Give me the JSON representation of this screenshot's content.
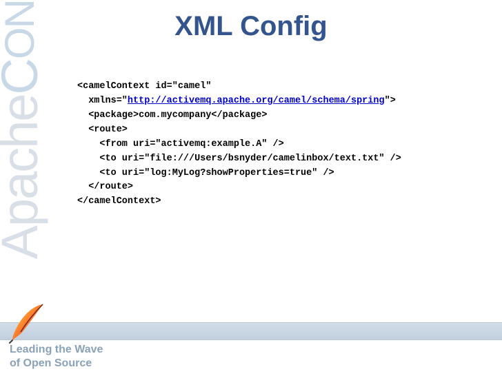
{
  "brand": {
    "part1": "Apache",
    "part2_c": "C",
    "part2_on": "ON"
  },
  "title": "XML Config",
  "code": {
    "line1": "<camelContext id=\"camel\"",
    "line2a": "  xmlns=\"",
    "line2_url": "http://activemq.apache.org/camel/schema/spring",
    "line2b": "\">",
    "line3": "  <package>com.mycompany</package>",
    "line4": "  <route>",
    "line5": "    <from uri=\"activemq:example.A\" />",
    "line6": "    <to uri=\"file:///Users/bsnyder/camelinbox/text.txt\" />",
    "line7": "    <to uri=\"log:MyLog?showProperties=true\" />",
    "line8": "  </route>",
    "line9": "</camelContext>"
  },
  "tagline": {
    "line1": "Leading the Wave",
    "line2": "of Open Source"
  }
}
